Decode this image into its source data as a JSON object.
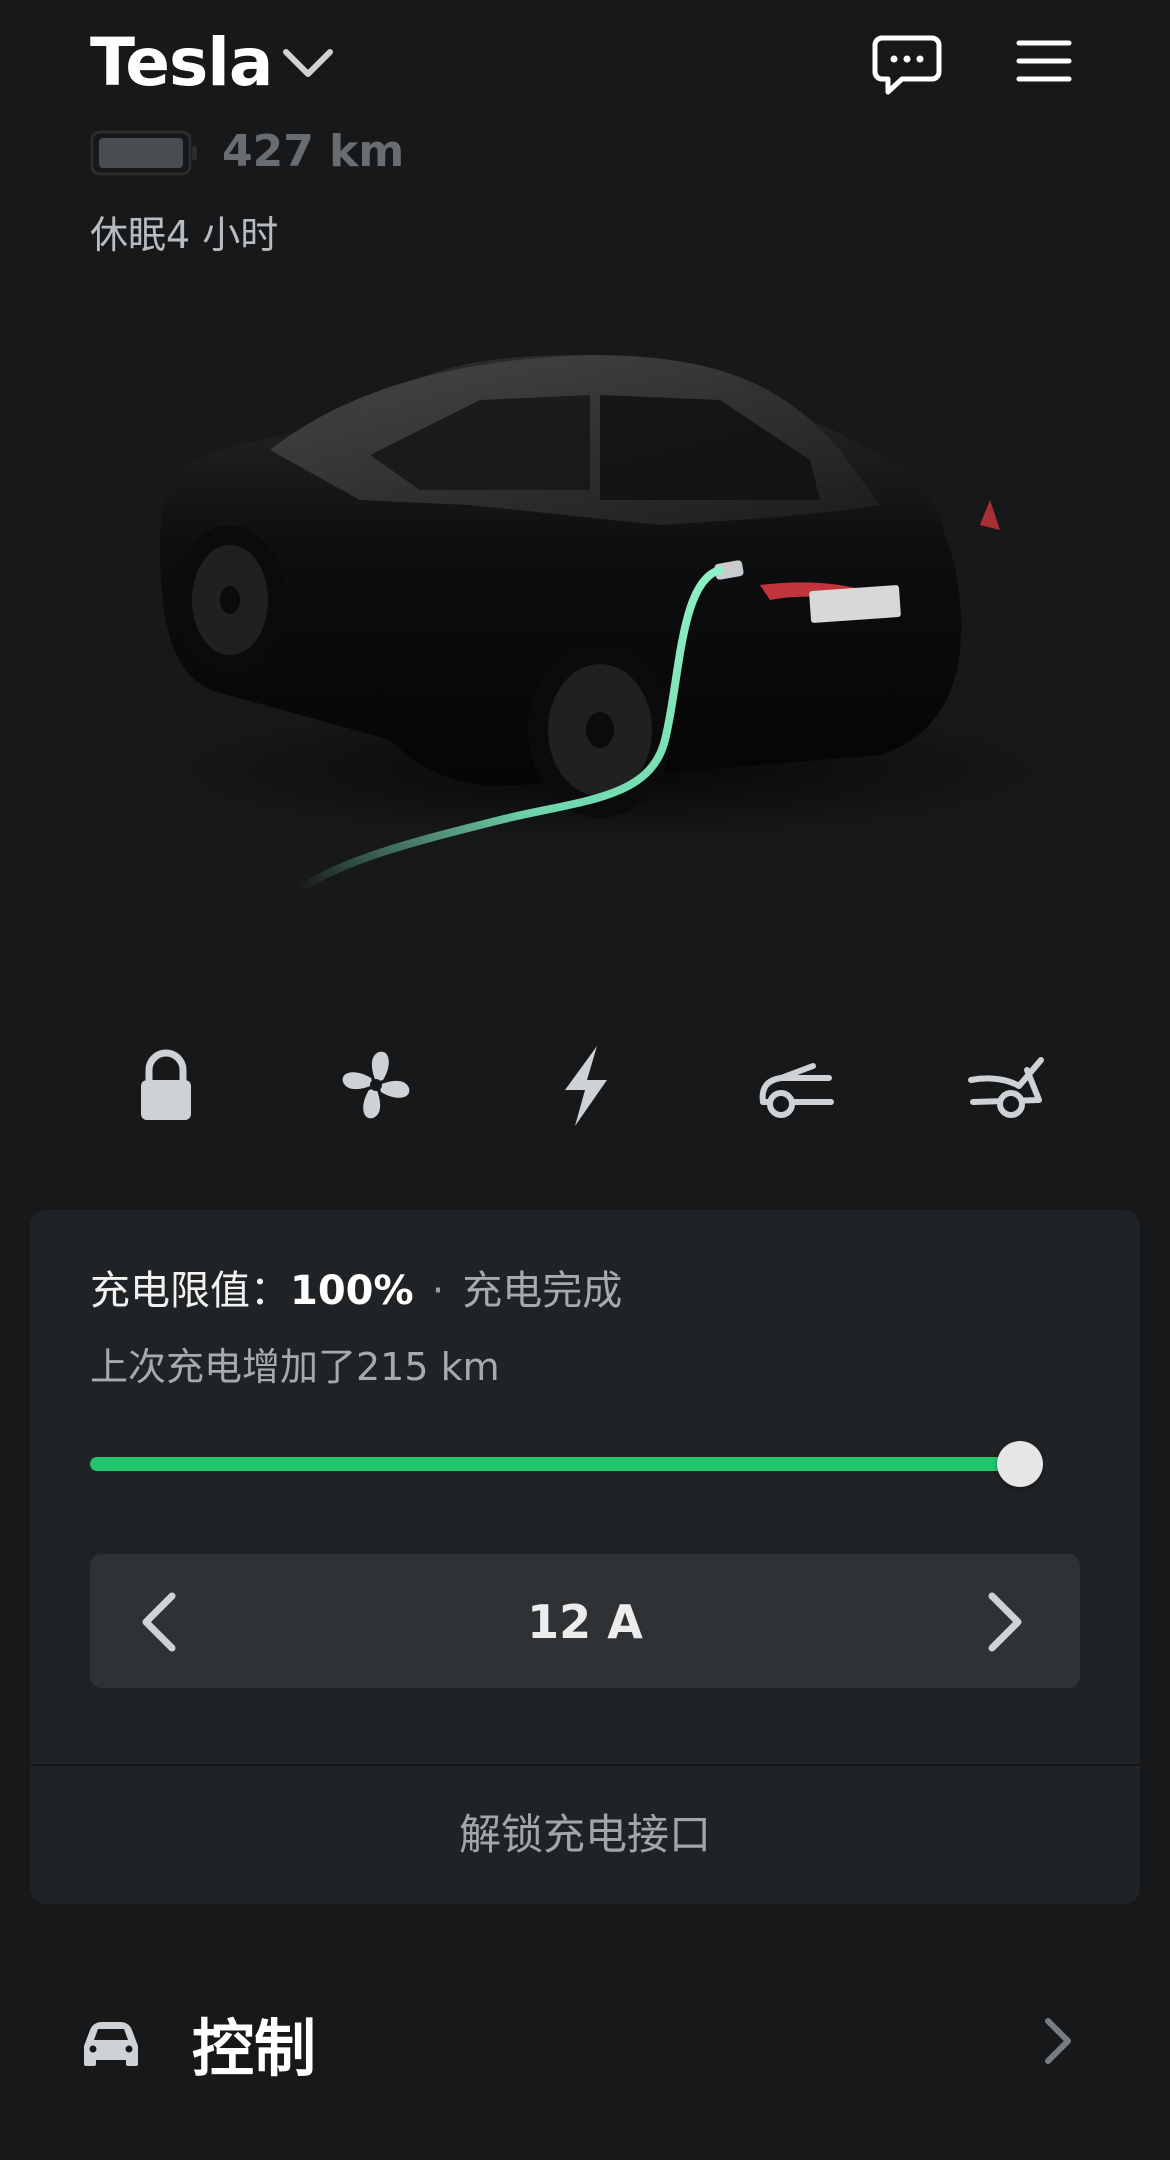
{
  "header": {
    "vehicle_name": "Tesla",
    "range": "427 km",
    "sleep_status": "休眠4 小时",
    "icons": [
      "chevron-down-icon",
      "chat-icon",
      "menu-icon"
    ]
  },
  "quick_actions": [
    "lock-icon",
    "fan-icon",
    "charge-bolt-icon",
    "frunk-icon",
    "trunk-icon"
  ],
  "charging": {
    "limit_label": "充电限值：",
    "limit_value": "100%",
    "separator": "·",
    "status": "充电完成",
    "added": "上次充电增加了215 km",
    "limit_fraction": 1.0,
    "current": "12 A",
    "unlock_port": "解锁充电接口"
  },
  "controls": {
    "label": "控制"
  },
  "colors": {
    "background": "#16181a",
    "card": "#202325",
    "accent_green": "#23c46e",
    "stepper": "#2f3234"
  }
}
